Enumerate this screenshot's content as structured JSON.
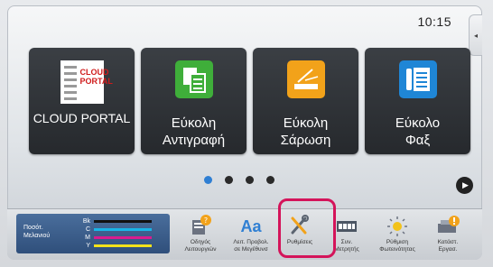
{
  "status": {
    "time": "10:15"
  },
  "side_tab": {
    "glyph": "◂"
  },
  "tiles": [
    {
      "label": "CLOUD PORTAL",
      "logo_text": "CLOUD\nPORTAL",
      "icon": "cloud-portal-icon",
      "color": "#d01b1b"
    },
    {
      "label": "Εύκολη\nΑντιγραφή",
      "icon": "copy-icon",
      "color": "#3fae3a"
    },
    {
      "label": "Εύκολη\nΣάρωση",
      "icon": "scan-icon",
      "color": "#f2a21a"
    },
    {
      "label": "Εύκολο\nΦαξ",
      "icon": "fax-icon",
      "color": "#1f86d6"
    }
  ],
  "pager": {
    "pages": 4,
    "active_index": 0,
    "next_glyph": "▶"
  },
  "toner": {
    "title": "Ποσότ.\nΜελανιού",
    "rows": [
      {
        "label": "Bk",
        "color": "#111111"
      },
      {
        "label": "C",
        "color": "#19b5e6"
      },
      {
        "label": "M",
        "color": "#d81c8f"
      },
      {
        "label": "Y",
        "color": "#f4e21a"
      }
    ]
  },
  "bottom_items": [
    {
      "label": "Οδηγός\nΛειτουργιών",
      "icon": "operation-guide-icon"
    },
    {
      "label": "Λειτ. Προβολ.\nσε Μεγέθυνσ",
      "icon": "enlarge-display-icon",
      "icon_text": "Aa"
    },
    {
      "label": "Ρυθμίσεις",
      "icon": "settings-wrench-icon"
    },
    {
      "label": "Συν.\nΜετρητής",
      "icon": "counter-icon"
    },
    {
      "label": "Ρύθμιση\nΦωτεινότητας",
      "icon": "brightness-icon"
    },
    {
      "label": "Κατάστ.\nΕργασ.",
      "icon": "job-status-icon"
    }
  ],
  "colors": {
    "accent_highlight": "#d4145a",
    "pager_active": "#2f7fd3"
  }
}
